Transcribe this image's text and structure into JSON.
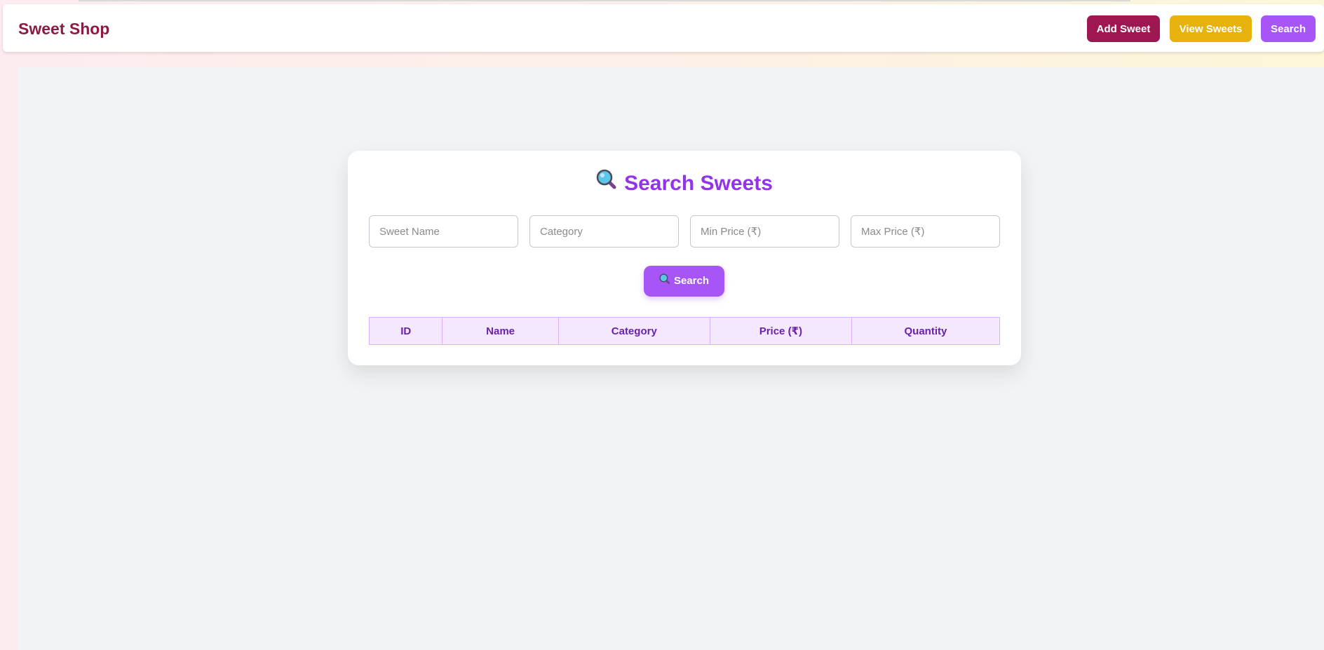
{
  "navbar": {
    "brand": "Sweet Shop",
    "add_label": "Add Sweet",
    "view_label": "View Sweets",
    "search_label": "Search"
  },
  "card": {
    "title": "Search Sweets",
    "fields": {
      "name_placeholder": "Sweet Name",
      "category_placeholder": "Category",
      "min_price_placeholder": "Min Price (₹)",
      "max_price_placeholder": "Max Price (₹)"
    },
    "search_button": "Search",
    "table": {
      "columns": [
        "ID",
        "Name",
        "Category",
        "Price (₹)",
        "Quantity"
      ],
      "rows": []
    }
  },
  "colors": {
    "brand": "#8b1a44",
    "add_button": "#9e1750",
    "view_button": "#e8b20d",
    "accent": "#a855f7",
    "title": "#9333ea",
    "table_header_bg": "#f3e8ff",
    "table_header_text": "#6b21a8"
  },
  "icons": {
    "title_icon": "magnifying-glass-icon",
    "button_icon": "magnifying-glass-icon"
  }
}
